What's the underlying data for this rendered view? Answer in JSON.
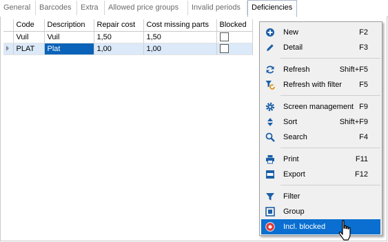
{
  "tabs": [
    "General",
    "Barcodes",
    "Extra",
    "Allowed price groups",
    "Invalid periods",
    "Deficiencies"
  ],
  "active_tab": "Deficiencies",
  "grid": {
    "columns": [
      "Code",
      "Description",
      "Repair cost",
      "Cost missing parts",
      "Blocked"
    ],
    "rows": [
      {
        "code": "Vuil",
        "description": "Vuil",
        "repair_cost": "1,50",
        "cost_missing_parts": "1,50",
        "blocked": false
      },
      {
        "code": "PLAT",
        "description": "Plat",
        "repair_cost": "1,00",
        "cost_missing_parts": "1,00",
        "blocked": false
      }
    ]
  },
  "context_menu": {
    "items": [
      {
        "label": "New",
        "shortcut": "F2",
        "icon": "plus-circle-icon"
      },
      {
        "label": "Detail",
        "shortcut": "F3",
        "icon": "pencil-icon"
      },
      {
        "label": "Refresh",
        "shortcut": "Shift+F5",
        "icon": "refresh-icon"
      },
      {
        "label": "Refresh with filter",
        "shortcut": "F5",
        "icon": "refresh-filter-icon"
      },
      {
        "label": "Screen management",
        "shortcut": "F9",
        "icon": "gear-icon"
      },
      {
        "label": "Sort",
        "shortcut": "Shift+F9",
        "icon": "sort-icon"
      },
      {
        "label": "Search",
        "shortcut": "F4",
        "icon": "search-icon"
      },
      {
        "label": "Print",
        "shortcut": "F11",
        "icon": "printer-icon"
      },
      {
        "label": "Export",
        "shortcut": "F12",
        "icon": "csv-export-icon"
      },
      {
        "label": "Filter",
        "shortcut": "",
        "icon": "funnel-icon"
      },
      {
        "label": "Group",
        "shortcut": "",
        "icon": "group-icon"
      },
      {
        "label": "Incl. blocked",
        "shortcut": "",
        "icon": "blocked-toggle-icon"
      }
    ],
    "highlighted": "Incl. blocked"
  },
  "colors": {
    "accent": "#0a6fd0",
    "icon_blue": "#1b5fa8",
    "selected_cell": "#0a63b8",
    "selected_row": "#dbe9f9",
    "blocked_icon": "#e23a3a"
  }
}
